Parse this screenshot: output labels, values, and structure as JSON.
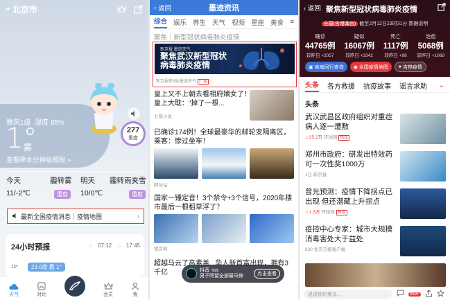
{
  "weather": {
    "city": "北京市",
    "wind": "微风1级",
    "humidity": "湿度 85%",
    "temp": "1°",
    "condition": "雾",
    "forecast_link": "查看降水分钟级预报 »",
    "aqi_value": "277",
    "aqi_level": "重度",
    "today_label": "今天",
    "today_cond": "霾转雾",
    "today_temp": "11/-2℃",
    "today_badge": "重度",
    "tomorrow_label": "明天",
    "tomorrow_cond": "霾转雨夹雪",
    "tomorrow_temp": "10/0℃",
    "tomorrow_badge": "重度",
    "banner": "最新全国疫情消息｜疫情地图",
    "hourly_title": "24小时预报",
    "sunrise": "07:12",
    "sunset": "17:45",
    "hourly_pill": "23.0度 霾 1°",
    "hourly_axis": "10°",
    "nav": [
      "天气",
      "对比",
      "",
      "会员",
      "我"
    ],
    "accent": "#3a8be8"
  },
  "news": {
    "back": "返回",
    "title": "墨迹资讯",
    "tabs": [
      "综合",
      "娱乐",
      "养生",
      "天气",
      "视频",
      "星座",
      "美食"
    ],
    "focus": "聚焦｜新型冠状病毒肺炎疫情",
    "banner_logos": "新京报  墨迹天气",
    "banner_text": "聚焦武汉新型冠状病毒肺炎疫情",
    "banner_source": "新京报新闻&墨迹天气",
    "banner_ad": "广告",
    "items": [
      {
        "title": "皇上又不上朝去看相府嫡女了！皇上大耽：“掉了一根...",
        "meta": "七猫小说"
      },
      {
        "title": "已确诊174例！全球最豪华的邮轮变隔离区，乘客：惨过坐牢！",
        "meta": "网址站"
      },
      {
        "title": "国家一锤定音！3个禁令+3个信号，2020年楼市最后一根稻草浮了？",
        "meta": "楼房网"
      },
      {
        "title": "超越马云了高素盖...华人新首富出现，拥有3千亿",
        "meta": ""
      }
    ],
    "popup_title": "抖音 -ios",
    "popup_sub": "男子阿留全部最马修",
    "popup_btn": "点击查看"
  },
  "covid": {
    "back": "返回",
    "title": "聚焦新型冠状病毒肺炎疫情",
    "updated_tag": "全国(含港澳台)",
    "updated": "截至2月12日23时31分 数据说明",
    "stats": [
      {
        "label": "确诊",
        "value": "44765例",
        "diff": "较昨日 +2057"
      },
      {
        "label": "疑似",
        "value": "16067例",
        "diff": "较昨日 +3342"
      },
      {
        "label": "死亡",
        "value": "1117例",
        "diff": "较昨日 +98"
      },
      {
        "label": "治愈",
        "value": "5068例",
        "diff": "较昨日 +1069"
      }
    ],
    "buttons": [
      "疾病同行查询",
      "全国疫情地图",
      "吉林疫情"
    ],
    "tabs": [
      "头条",
      "各方救援",
      "抗疫故事",
      "谣言求助"
    ],
    "section": "头条",
    "items": [
      {
        "title": "武汉武昌区政府组织对重症病人逐一遭敷",
        "hot": "25.2万",
        "source": "环球网",
        "tag": "热议"
      },
      {
        "title": "郑州市政府：研发出特效药可一次性奖1000万",
        "hot": "",
        "source": "1日 新京报",
        "tag": ""
      },
      {
        "title": "曾光预测：疫情下降拐点已出现 但还潜藏上升拐点",
        "hot": "1.3万",
        "source": "环球网",
        "tag": "热议"
      },
      {
        "title": "疫控中心专家：城市大规模消毒害处大于益处",
        "hot": "",
        "source": "830 北京日报客户端",
        "tag": ""
      }
    ],
    "input_placeholder": "说说你的看法...",
    "comment_count": "999+",
    "accent": "#e0393e"
  }
}
